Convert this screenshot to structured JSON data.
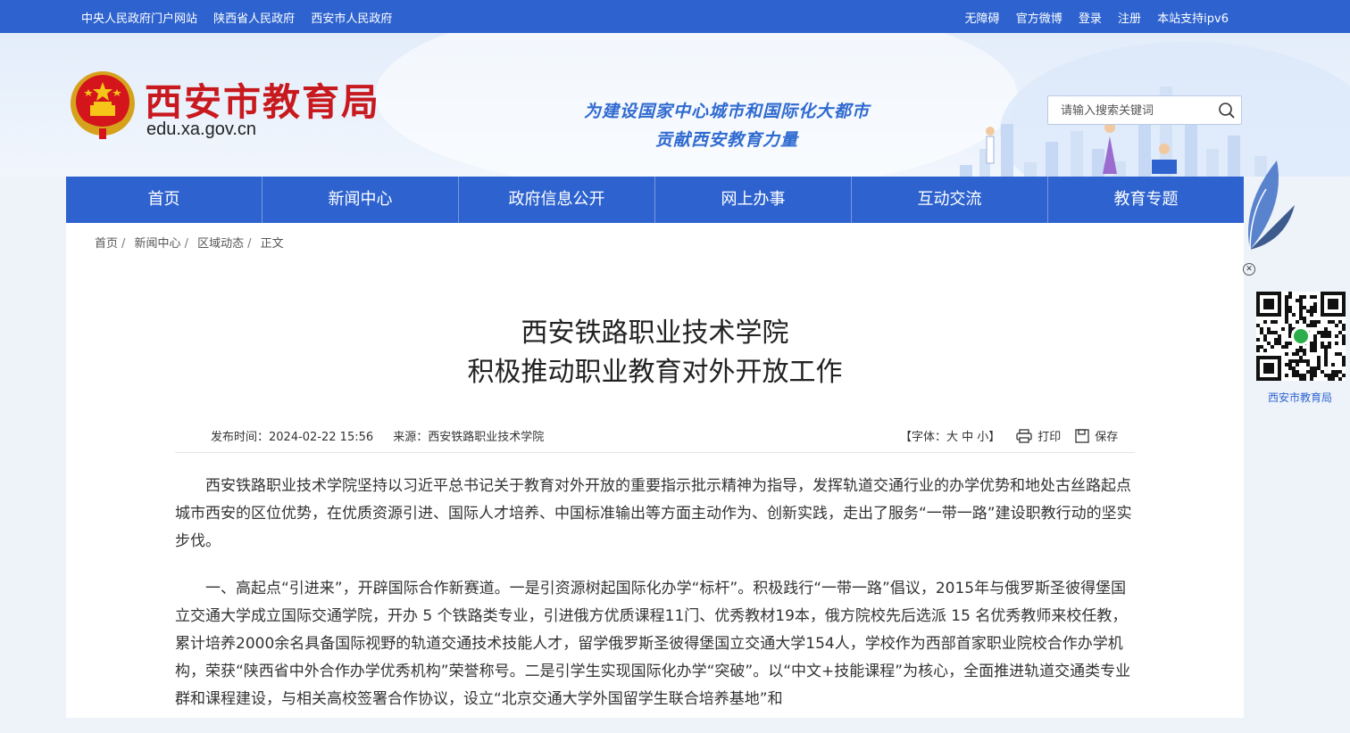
{
  "topbar": {
    "links_left": [
      "中央人民政府门户网站",
      "陕西省人民政府",
      "西安市人民政府"
    ],
    "links_right": [
      "无障碍",
      "官方微博",
      "登录",
      "注册",
      "本站支持ipv6"
    ]
  },
  "header": {
    "site_title": "西安市教育局",
    "domain": "edu.xa.gov.cn",
    "slogan_line1": "为建设国家中心城市和国际化大都市",
    "slogan_line2": "贡献西安教育力量",
    "search_placeholder": "请输入搜索关键词"
  },
  "nav": {
    "items": [
      "首页",
      "新闻中心",
      "政府信息公开",
      "网上办事",
      "互动交流",
      "教育专题"
    ]
  },
  "breadcrumb": [
    "首页",
    "新闻中心",
    "区域动态",
    "正文"
  ],
  "article": {
    "title_line1": "西安铁路职业技术学院",
    "title_line2": "积极推动职业教育对外开放工作",
    "publish_time": "发布时间：2024-02-22 15:56",
    "source": "来源：西安铁路职业技术学院",
    "font_size_label": "【字体：大 中 小】",
    "print_label": "打印",
    "save_label": "保存",
    "paragraphs": [
      "西安铁路职业技术学院坚持以习近平总书记关于教育对外开放的重要指示批示精神为指导，发挥轨道交通行业的办学优势和地处古丝路起点城市西安的区位优势，在优质资源引进、国际人才培养、中国标准输出等方面主动作为、创新实践，走出了服务“一带一路”建设职教行动的坚实步伐。",
      "一、高起点“引进来”，开辟国际合作新赛道。一是引资源树起国际化办学“标杆”。积极践行“一带一路”倡议，2015年与俄罗斯圣彼得堡国立交通大学成立国际交通学院，开办 5 个铁路类专业，引进俄方优质课程11门、优秀教材19本，俄方院校先后选派 15 名优秀教师来校任教，累计培养2000余名具备国际视野的轨道交通技术技能人才，留学俄罗斯圣彼得堡国立交通大学154人，学校作为西部首家职业院校合作办学机构，荣获“陕西省中外合作办学优秀机构”荣誉称号。二是引学生实现国际化办学“突破”。以“中文+技能课程”为核心，全面推进轨道交通类专业群和课程建设，与相关高校签署合作协议，设立“北京交通大学外国留学生联合培养基地”和"
    ]
  },
  "qr": {
    "caption": "西安市教育局"
  }
}
